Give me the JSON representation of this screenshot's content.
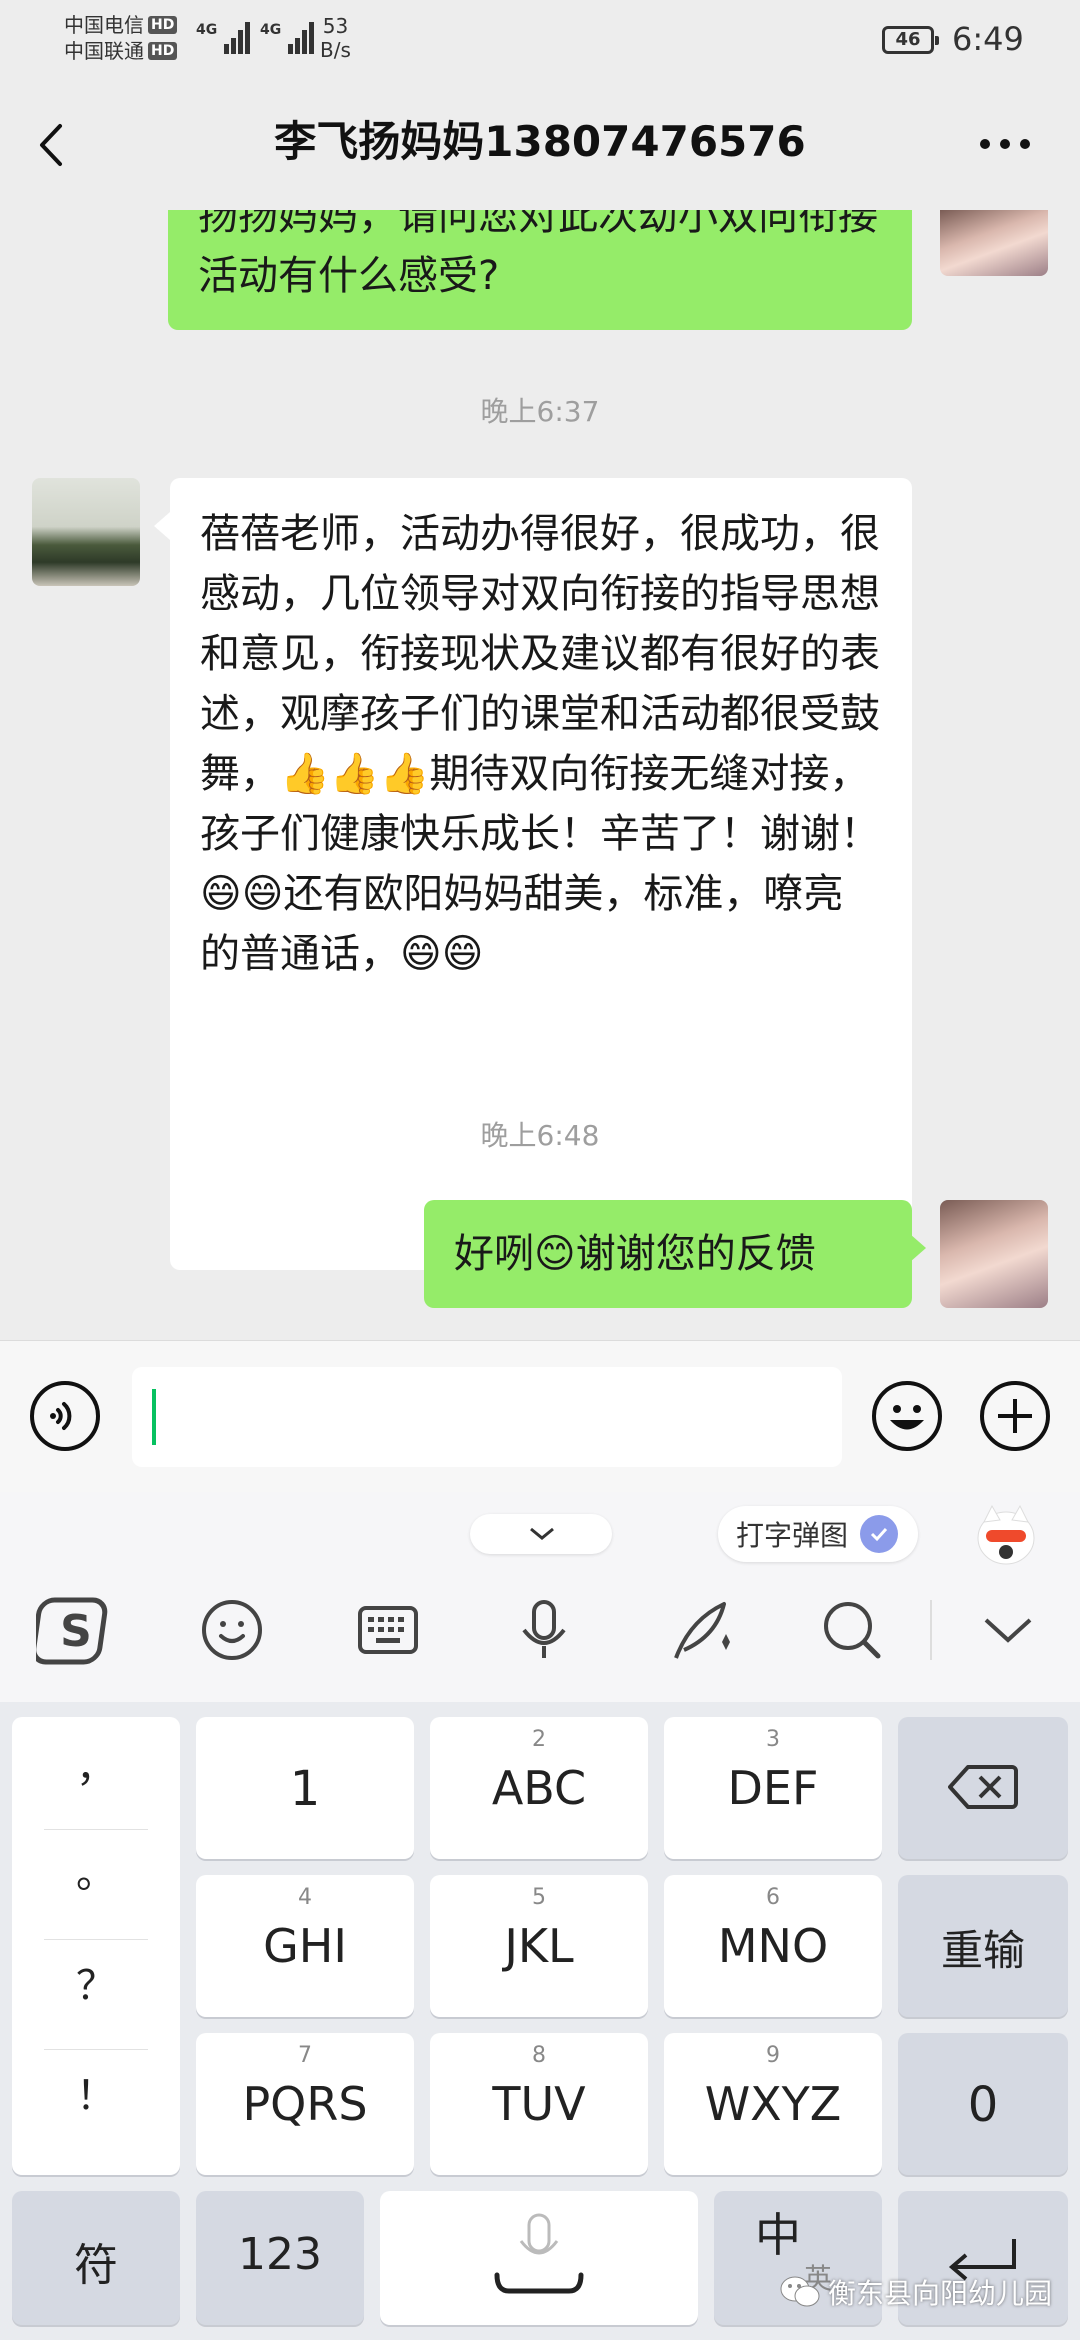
{
  "status_bar": {
    "carrier_1": "中国电信",
    "carrier_2": "中国联通",
    "hd": "HD",
    "network_1": "4G",
    "network_2": "4G",
    "speed_value": "53",
    "speed_unit": "B/s",
    "battery": "46",
    "time": "6:49"
  },
  "header": {
    "title": "李飞扬妈妈13807476576"
  },
  "chat": {
    "messages": [
      {
        "from": "me",
        "text": "扬扬妈妈，请问您对此次幼小双向衔接活动有什么感受?"
      },
      {
        "type": "time",
        "text": "晚上6:37"
      },
      {
        "from": "other",
        "text": "蓓蓓老师，活动办得很好，很成功，很感动，几位领导对双向衔接的指导思想和意见，衔接现状及建议都有很好的表述，观摩孩子们的课堂和活动都很受鼓舞，👍👍👍期待双向衔接无缝对接，孩子们健康快乐成长！辛苦了！谢谢！😄😄还有欧阳妈妈甜美，标准，嘹亮的普通话，😄😄"
      },
      {
        "type": "time",
        "text": "晚上6:48"
      },
      {
        "from": "me",
        "text": "好咧😊谢谢您的反馈"
      }
    ]
  },
  "keyboard": {
    "toolbar_chip": "打字弹图",
    "symbols": [
      "，",
      "。",
      "？",
      "！"
    ],
    "rows": [
      [
        {
          "num": "",
          "label": "1"
        },
        {
          "num": "2",
          "label": "ABC"
        },
        {
          "num": "3",
          "label": "DEF"
        }
      ],
      [
        {
          "num": "4",
          "label": "GHI"
        },
        {
          "num": "5",
          "label": "JKL"
        },
        {
          "num": "6",
          "label": "MNO"
        }
      ],
      [
        {
          "num": "7",
          "label": "PQRS"
        },
        {
          "num": "8",
          "label": "TUV"
        },
        {
          "num": "9",
          "label": "WXYZ"
        }
      ]
    ],
    "reinput": "重输",
    "zero": "0",
    "sym_key": "符",
    "num_key": "123",
    "lang_key": "中",
    "lang_sub": "英"
  },
  "watermark": "衡东县向阳幼儿园"
}
